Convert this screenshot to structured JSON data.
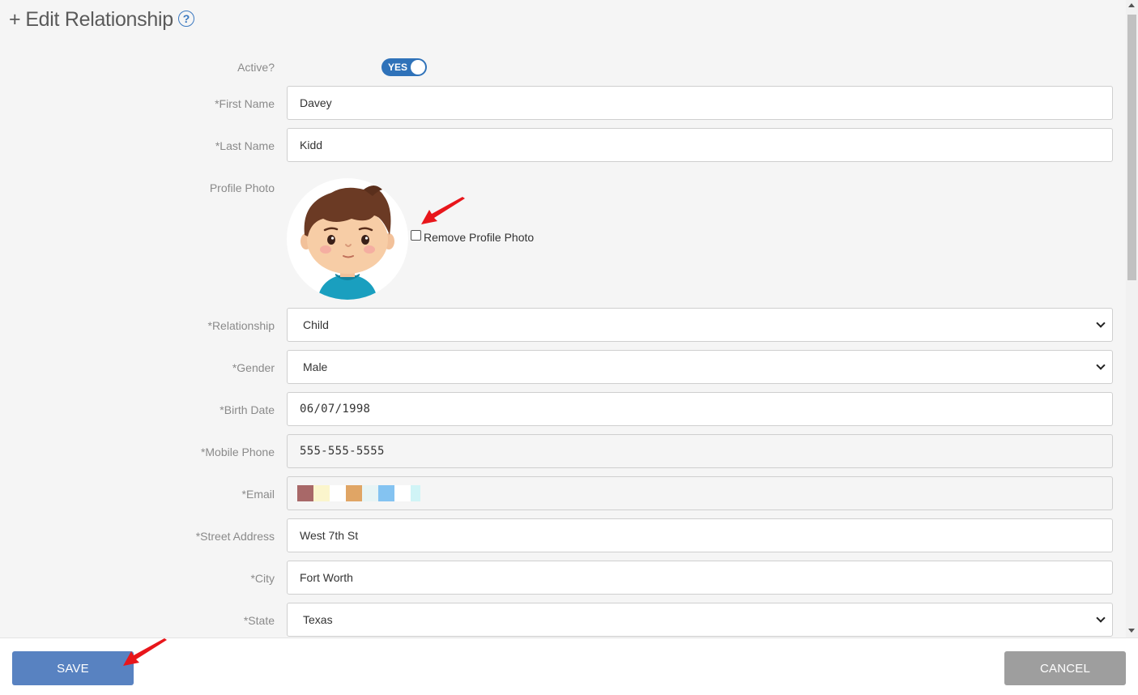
{
  "header": {
    "title_prefix": "+",
    "title": "Edit Relationship",
    "help_icon": "question-circle-icon"
  },
  "form": {
    "active_label": "Active?",
    "active_toggle": "YES",
    "first_name": {
      "label": "*First Name",
      "value": "Davey"
    },
    "last_name": {
      "label": "*Last Name",
      "value": "Kidd"
    },
    "profile_photo": {
      "label": "Profile Photo",
      "remove_label": "Remove Profile Photo"
    },
    "relationship": {
      "label": "*Relationship",
      "value": "Child"
    },
    "gender": {
      "label": "*Gender",
      "value": "Male"
    },
    "birth_date": {
      "label": "*Birth Date",
      "value": "06/07/1998"
    },
    "mobile_phone": {
      "label": "*Mobile Phone",
      "value": "555-555-5555"
    },
    "email": {
      "label": "*Email",
      "redacted_colors": [
        "#a86868",
        "#fbf5cc",
        "#ffffff",
        "#e0a565",
        "#e7f4f5",
        "#84c3f1",
        "#ffffff",
        "#d0f4f6"
      ]
    },
    "street_address": {
      "label": "*Street Address",
      "value": "West 7th St"
    },
    "city": {
      "label": "*City",
      "value": "Fort Worth"
    },
    "state": {
      "label": "*State",
      "value": "Texas"
    }
  },
  "footer": {
    "save_label": "SAVE",
    "cancel_label": "CANCEL"
  },
  "colors": {
    "accent": "#2f72b9",
    "save": "#5882c1",
    "cancel": "#9e9e9e",
    "annotation_arrow": "#e8161b"
  }
}
